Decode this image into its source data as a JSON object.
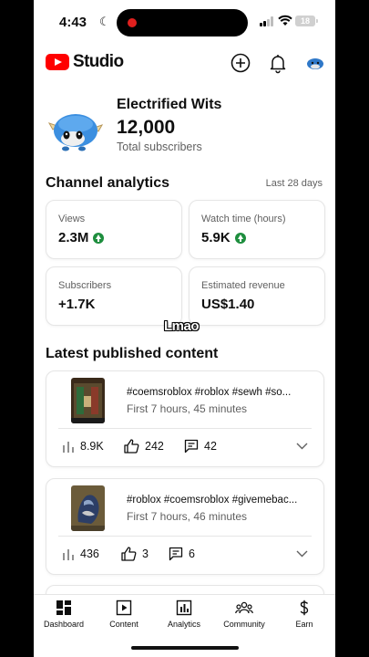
{
  "status": {
    "time": "4:43",
    "battery": "18"
  },
  "header": {
    "brand": "Studio"
  },
  "channel": {
    "name": "Electrified Wits",
    "subscribers": "12,000",
    "sub_label": "Total subscribers"
  },
  "analytics": {
    "title": "Channel analytics",
    "period": "Last 28 days",
    "metrics": [
      {
        "label": "Views",
        "value": "2.3M",
        "trend": "up"
      },
      {
        "label": "Watch time (hours)",
        "value": "5.9K",
        "trend": "up"
      },
      {
        "label": "Subscribers",
        "value": "+1.7K",
        "trend": ""
      },
      {
        "label": "Estimated revenue",
        "value": "US$1.40",
        "trend": ""
      }
    ]
  },
  "overlay": {
    "caption": "Lmao"
  },
  "latest": {
    "title": "Latest published content",
    "videos": [
      {
        "title": "#coemsroblox #roblox #sewh #so...",
        "subtitle": "First 7 hours, 45 minutes",
        "views": "8.9K",
        "likes": "242",
        "comments": "42"
      },
      {
        "title": "#roblox #coemsroblox #givemebac...",
        "subtitle": "First 7 hours, 46 minutes",
        "views": "436",
        "likes": "3",
        "comments": "6"
      }
    ]
  },
  "tabs": [
    {
      "label": "Dashboard",
      "icon": "dashboard-icon"
    },
    {
      "label": "Content",
      "icon": "content-icon"
    },
    {
      "label": "Analytics",
      "icon": "analytics-icon"
    },
    {
      "label": "Community",
      "icon": "community-icon"
    },
    {
      "label": "Earn",
      "icon": "earn-icon"
    }
  ],
  "colors": {
    "brand_red": "#ff0000",
    "trend_green": "#1e8e3e",
    "text": "#0f0f0f",
    "muted": "#606060"
  }
}
